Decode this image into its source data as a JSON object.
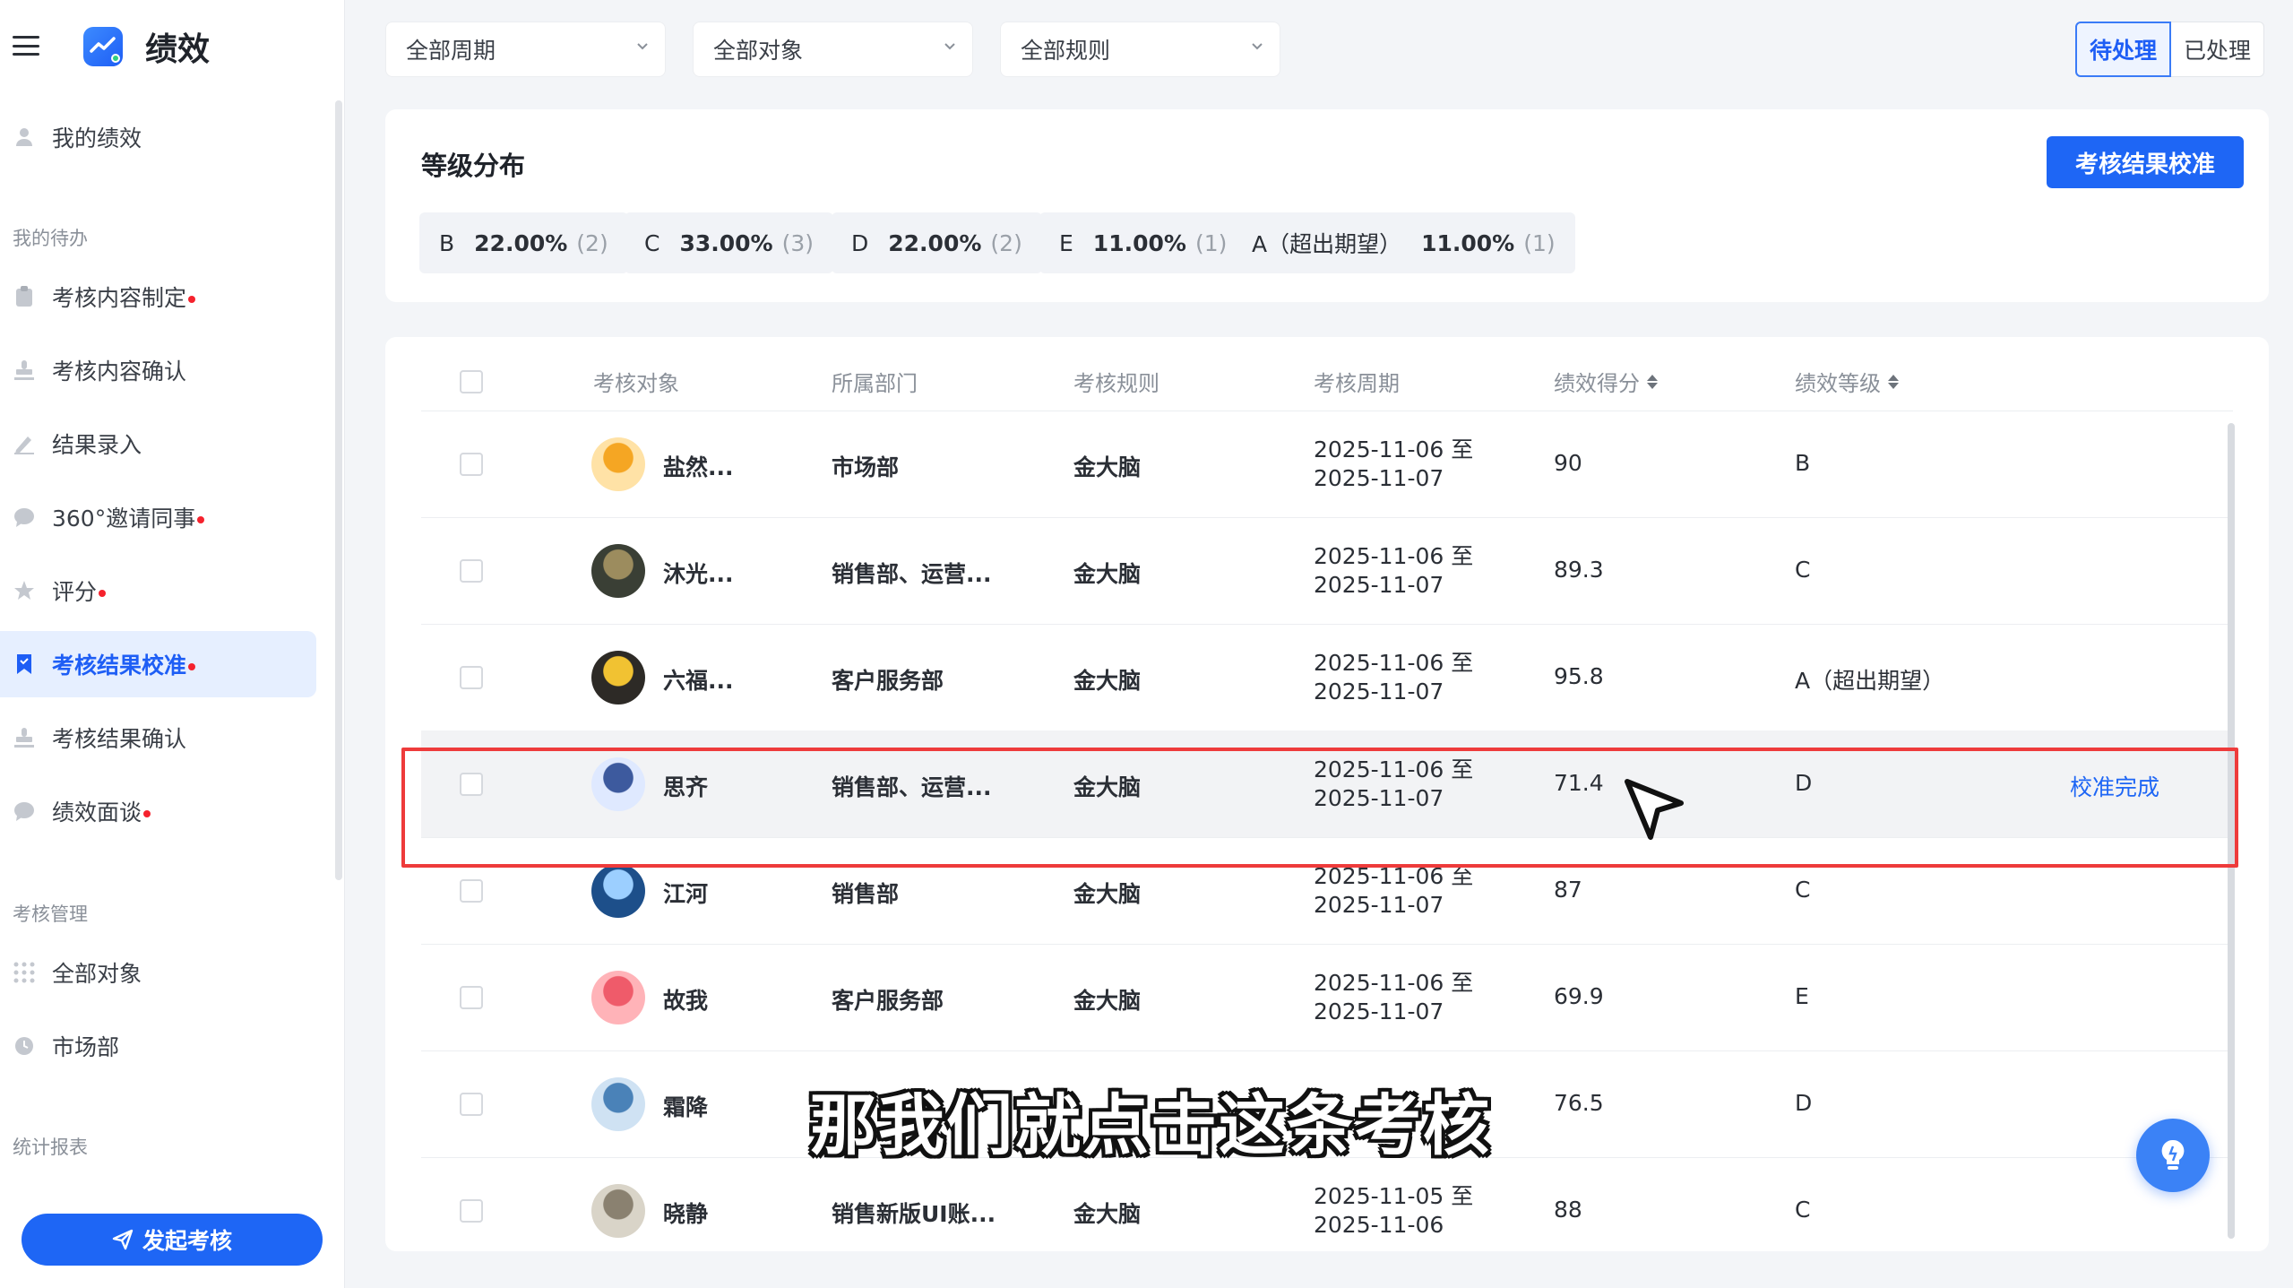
{
  "app": {
    "title": "绩效"
  },
  "sidebar": {
    "items": [
      {
        "label": "我的绩效",
        "icon": "user-icon",
        "dot": false,
        "active": false
      },
      {
        "label": "考核内容制定",
        "icon": "clipboard-icon",
        "dot": true,
        "active": false
      },
      {
        "label": "考核内容确认",
        "icon": "stamp-icon",
        "dot": false,
        "active": false
      },
      {
        "label": "结果录入",
        "icon": "pen-icon",
        "dot": false,
        "active": false
      },
      {
        "label": "360°邀请同事",
        "icon": "chat-icon",
        "dot": true,
        "active": false
      },
      {
        "label": "评分",
        "icon": "star-icon",
        "dot": true,
        "active": false
      },
      {
        "label": "考核结果校准",
        "icon": "bookmark-icon",
        "dot": true,
        "active": true
      },
      {
        "label": "考核结果确认",
        "icon": "stamp-icon",
        "dot": false,
        "active": false
      },
      {
        "label": "绩效面谈",
        "icon": "chat-icon",
        "dot": true,
        "active": false
      },
      {
        "label": "全部对象",
        "icon": "grid-icon",
        "dot": false,
        "active": false
      },
      {
        "label": "市场部",
        "icon": "clock-icon",
        "dot": false,
        "active": false
      }
    ],
    "sections": {
      "todo": "我的待办",
      "manage": "考核管理",
      "report": "统计报表"
    },
    "launch_button": "发起考核"
  },
  "filters": {
    "period": "全部周期",
    "target": "全部对象",
    "rule": "全部规则"
  },
  "status_tabs": {
    "pending": "待处理",
    "done": "已处理"
  },
  "grade_distribution": {
    "title": "等级分布",
    "calibrate_button": "考核结果校准",
    "chips": [
      {
        "grade": "B",
        "percent": "22.00%",
        "count": "(2)"
      },
      {
        "grade": "C",
        "percent": "33.00%",
        "count": "(3)"
      },
      {
        "grade": "D",
        "percent": "22.00%",
        "count": "(2)"
      },
      {
        "grade": "E",
        "percent": "11.00%",
        "count": "(1)"
      },
      {
        "grade": "A（超出期望）",
        "percent": "11.00%",
        "count": "(1)"
      }
    ]
  },
  "table": {
    "headers": {
      "target": "考核对象",
      "dept": "所属部门",
      "rule": "考核规则",
      "period": "考核周期",
      "score": "绩效得分",
      "grade": "绩效等级"
    },
    "rows": [
      {
        "name": "盐然...",
        "dept": "市场部",
        "rule": "金大脑",
        "period_start": "2025-11-06 至",
        "period_end": "2025-11-07",
        "score": "90",
        "grade": "B",
        "action": ""
      },
      {
        "name": "沐光...",
        "dept": "销售部、运营...",
        "rule": "金大脑",
        "period_start": "2025-11-06 至",
        "period_end": "2025-11-07",
        "score": "89.3",
        "grade": "C",
        "action": ""
      },
      {
        "name": "六福...",
        "dept": "客户服务部",
        "rule": "金大脑",
        "period_start": "2025-11-06 至",
        "period_end": "2025-11-07",
        "score": "95.8",
        "grade": "A（超出期望）",
        "action": ""
      },
      {
        "name": "思齐",
        "dept": "销售部、运营...",
        "rule": "金大脑",
        "period_start": "2025-11-06 至",
        "period_end": "2025-11-07",
        "score": "71.4",
        "grade": "D",
        "action": "校准完成"
      },
      {
        "name": "江河",
        "dept": "销售部",
        "rule": "金大脑",
        "period_start": "2025-11-06 至",
        "period_end": "2025-11-07",
        "score": "87",
        "grade": "C",
        "action": ""
      },
      {
        "name": "故我",
        "dept": "客户服务部",
        "rule": "金大脑",
        "period_start": "2025-11-06 至",
        "period_end": "2025-11-07",
        "score": "69.9",
        "grade": "E",
        "action": ""
      },
      {
        "name": "霜降",
        "dept": "",
        "rule": "",
        "period_start": "",
        "period_end": "",
        "score": "76.5",
        "grade": "D",
        "action": ""
      },
      {
        "name": "晓静",
        "dept": "销售新版UI账...",
        "rule": "金大脑",
        "period_start": "2025-11-05 至",
        "period_end": "2025-11-06",
        "score": "88",
        "grade": "C",
        "action": ""
      }
    ]
  },
  "caption": "那我们就点击这条考核",
  "colors": {
    "accent": "#1e66f5",
    "highlight_frame": "#ee3b3b",
    "badge_dot": "#f5222d"
  }
}
